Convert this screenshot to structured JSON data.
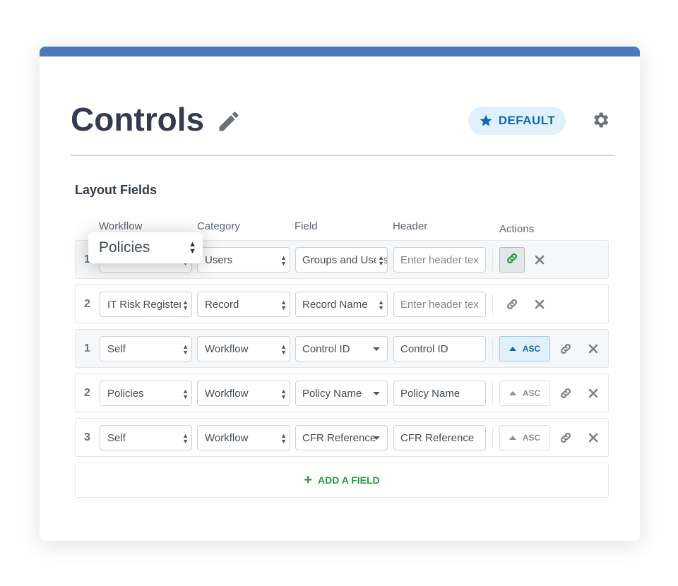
{
  "header": {
    "title": "Controls",
    "badge": "DEFAULT",
    "edit_icon": "pencil-icon",
    "badge_icon": "star-icon",
    "settings_icon": "gear-icon"
  },
  "section_title": "Layout Fields",
  "columns": [
    "Workflow",
    "Category",
    "Field",
    "Header",
    "Actions"
  ],
  "header_placeholder": "Enter header text",
  "rows": [
    {
      "num": "1",
      "workflow": "Policies",
      "category": "Users",
      "field": "Groups and Users",
      "header": "",
      "sort": null,
      "link_active": true
    },
    {
      "num": "2",
      "workflow": "IT Risk Register",
      "category": "Record",
      "field": "Record Name",
      "header": "",
      "sort": null,
      "link_active": false
    },
    {
      "num": "1",
      "workflow": "Self",
      "category": "Workflow",
      "field": "Control ID",
      "header": "Control ID",
      "sort": "ASC",
      "sort_active": true
    },
    {
      "num": "2",
      "workflow": "Policies",
      "category": "Workflow",
      "field": "Policy Name",
      "header": "Policy Name",
      "sort": "ASC",
      "sort_active": false
    },
    {
      "num": "3",
      "workflow": "Self",
      "category": "Workflow",
      "field": "CFR Reference",
      "header": "CFR Reference",
      "sort": "ASC",
      "sort_active": false
    }
  ],
  "add_field_label": "ADD A FIELD",
  "popup": {
    "value": "Policies"
  },
  "colors": {
    "accent_bar": "#4a7abb",
    "badge_text": "#0f68b0",
    "badge_bg": "#e1f1fb",
    "add_green": "#239b3d",
    "link_active": "#239b3d"
  }
}
